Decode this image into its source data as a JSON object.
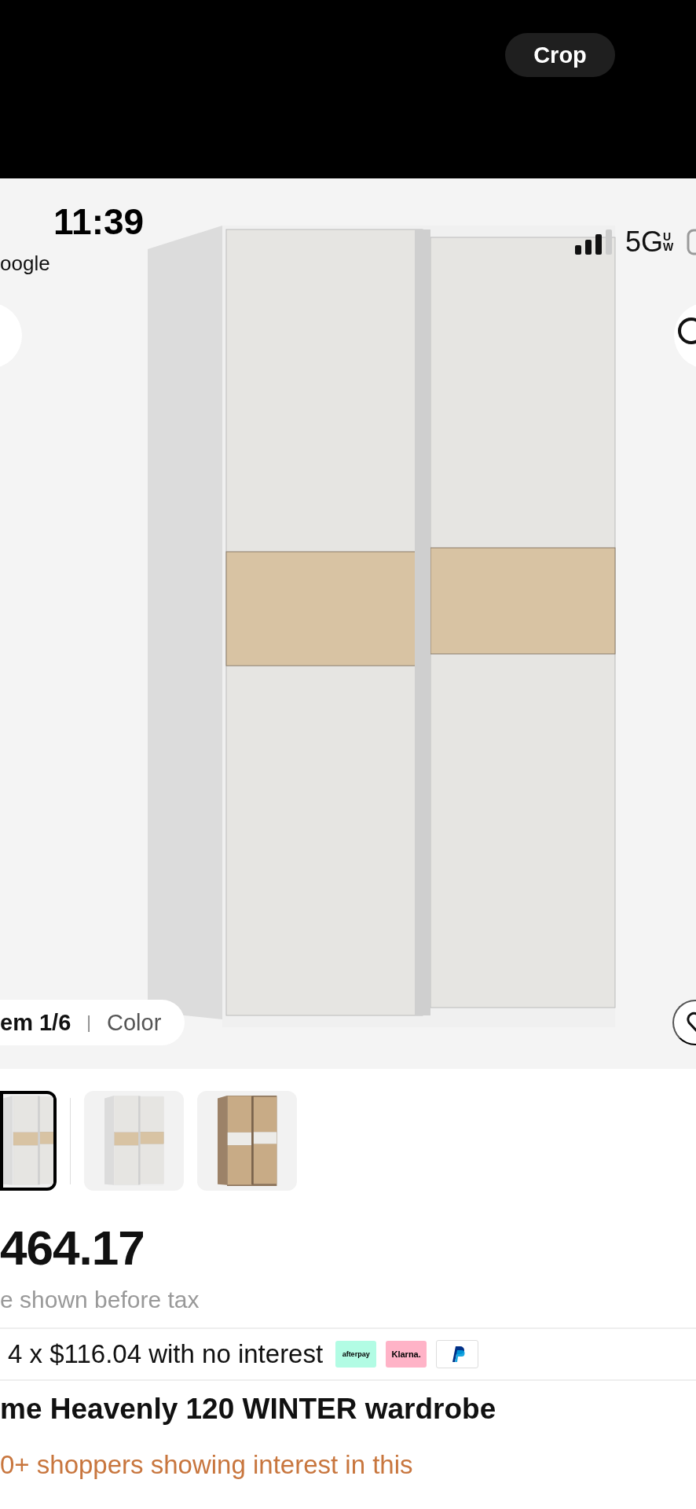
{
  "crop_button": {
    "label": "Crop"
  },
  "status_bar": {
    "time": "11:39",
    "back_app": "oogle",
    "network": "5G",
    "network_band": "UW"
  },
  "gallery": {
    "counter": "em 1/6",
    "separator": "|",
    "label": "Color"
  },
  "thumbnails": [
    {
      "kind": "white",
      "selected": true
    },
    {
      "kind": "white",
      "selected": false
    },
    {
      "kind": "oak",
      "selected": false
    }
  ],
  "price": {
    "amount": "464.17",
    "note": "e shown before tax"
  },
  "installments": {
    "text": "4 x $116.04 with no interest",
    "providers": [
      {
        "kind": "afterpay",
        "label": "afterpay"
      },
      {
        "kind": "klarna",
        "label": "Klarna."
      },
      {
        "kind": "paypal"
      }
    ]
  },
  "title": "me Heavenly 120 WINTER wardrobe",
  "interest": "0+ shoppers showing interest in this"
}
